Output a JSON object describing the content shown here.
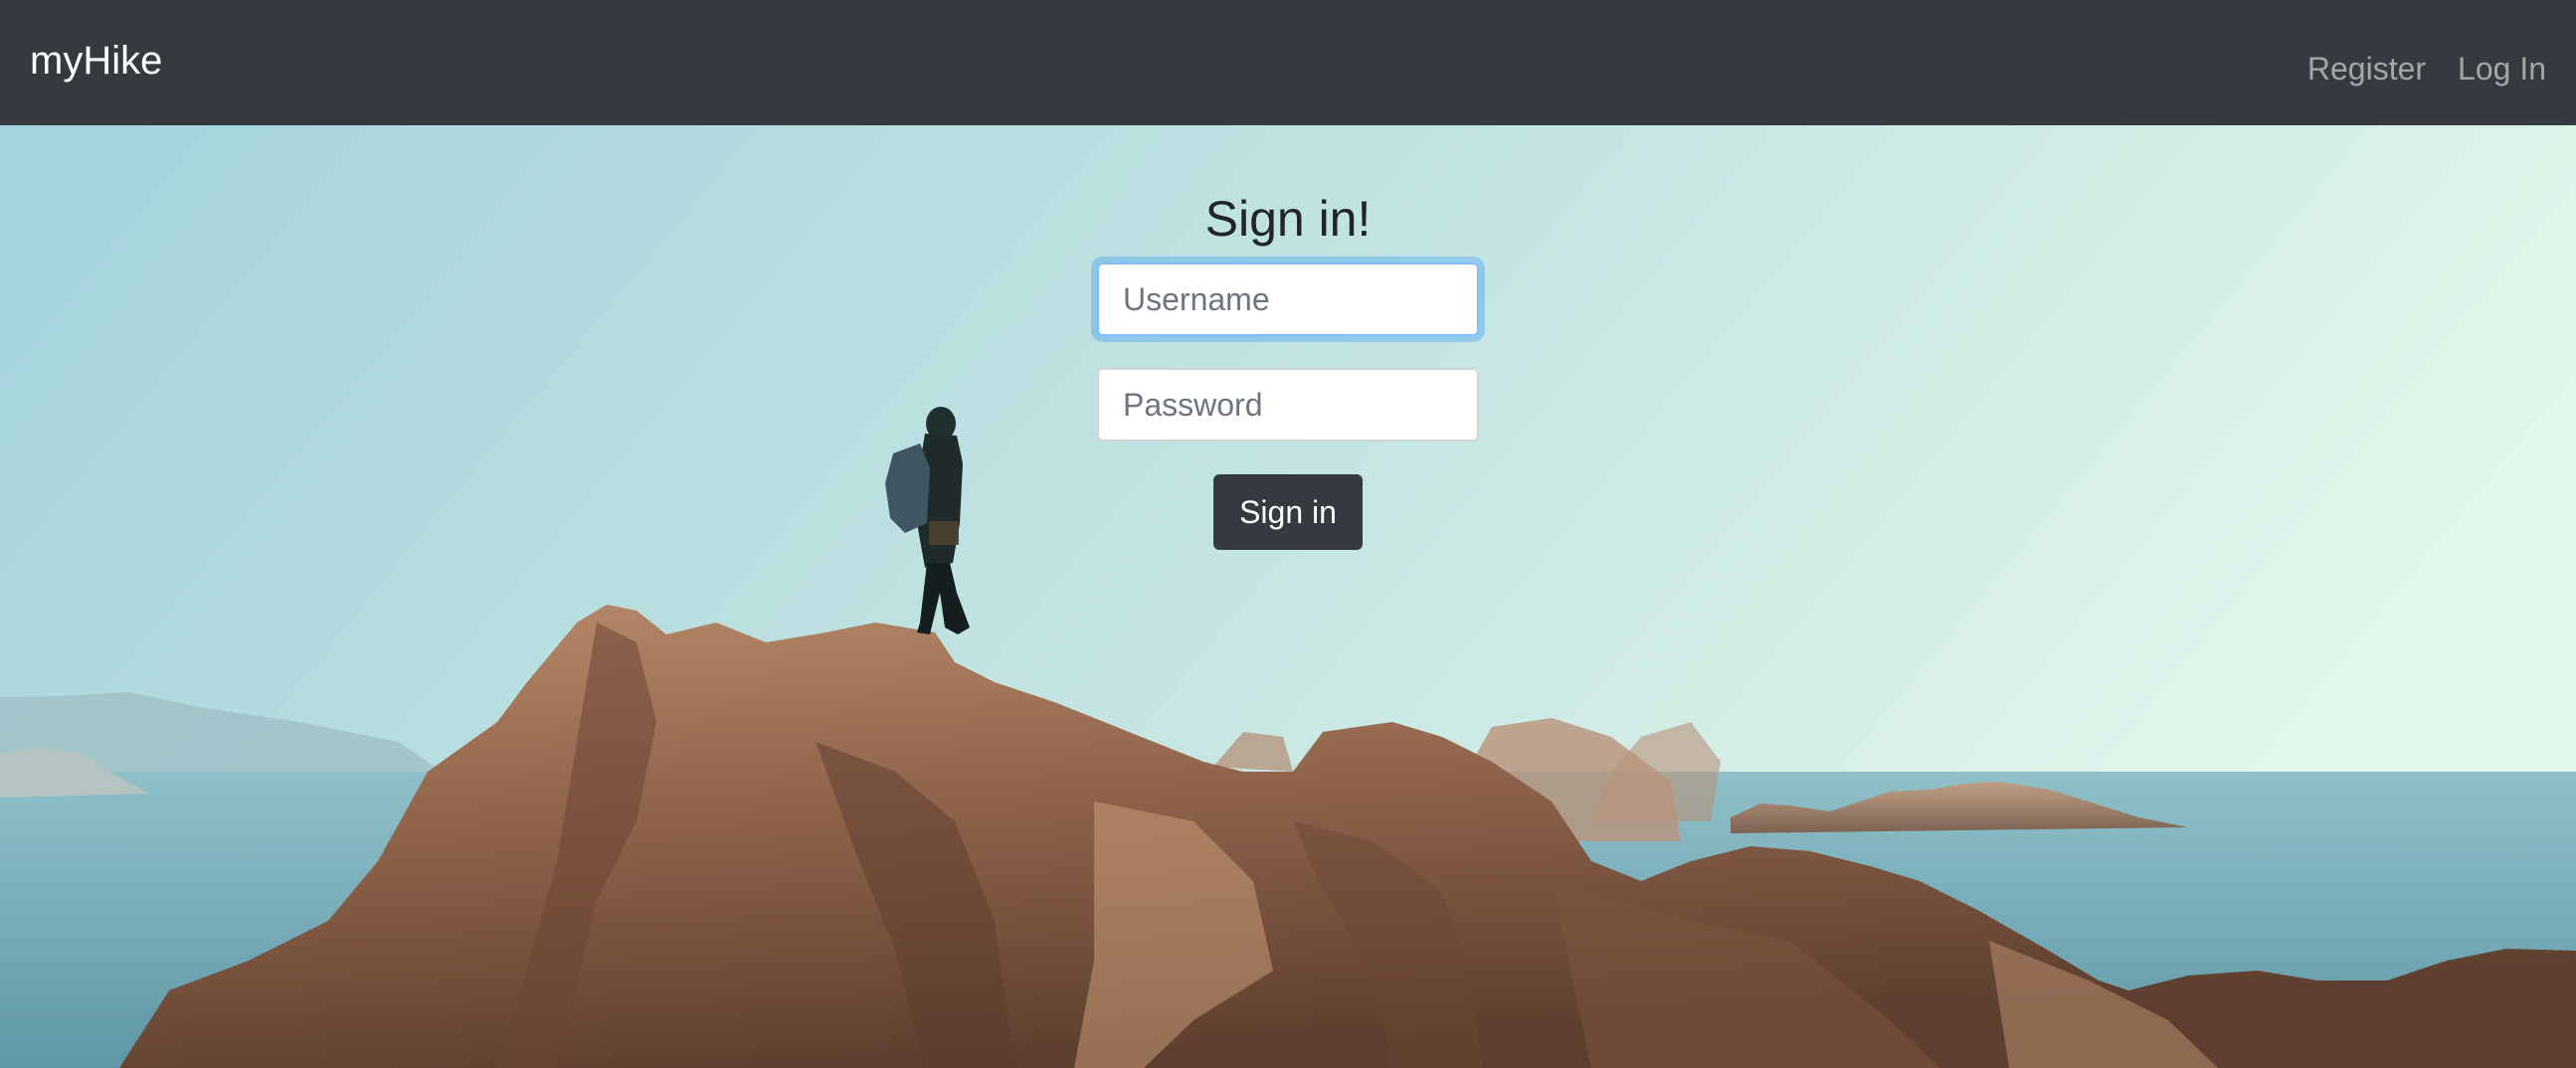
{
  "navbar": {
    "brand": "myHike",
    "links": [
      {
        "label": "Register"
      },
      {
        "label": "Log In"
      }
    ]
  },
  "login_form": {
    "title": "Sign in!",
    "username_placeholder": "Username",
    "password_placeholder": "Password",
    "submit_label": "Sign in"
  },
  "colors": {
    "navbar_bg": "#343a40",
    "button_bg": "#343a40",
    "focus_ring": "#80bdff"
  },
  "background": {
    "description_icon": "hiker-on-rocks-photo"
  }
}
